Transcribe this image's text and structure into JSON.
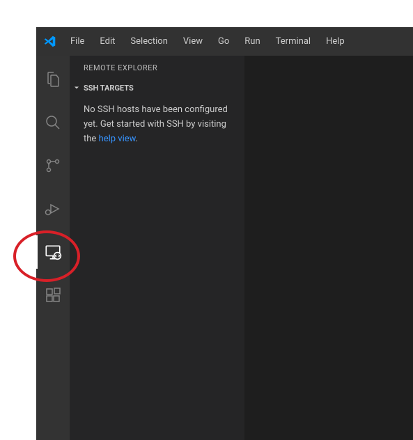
{
  "menubar": {
    "items": [
      "File",
      "Edit",
      "Selection",
      "View",
      "Go",
      "Run",
      "Terminal",
      "Help"
    ]
  },
  "activitybar": {
    "items": [
      {
        "name": "explorer",
        "active": false
      },
      {
        "name": "search",
        "active": false
      },
      {
        "name": "source-control",
        "active": false
      },
      {
        "name": "run-debug",
        "active": false
      },
      {
        "name": "remote-explorer",
        "active": true
      },
      {
        "name": "extensions",
        "active": false
      }
    ]
  },
  "sidebar": {
    "title": "REMOTE EXPLORER",
    "section": {
      "label": "SSH TARGETS",
      "empty_prefix": "No SSH hosts have been configured yet. Get started with SSH by visiting the ",
      "empty_link": "help view",
      "empty_suffix": "."
    }
  }
}
